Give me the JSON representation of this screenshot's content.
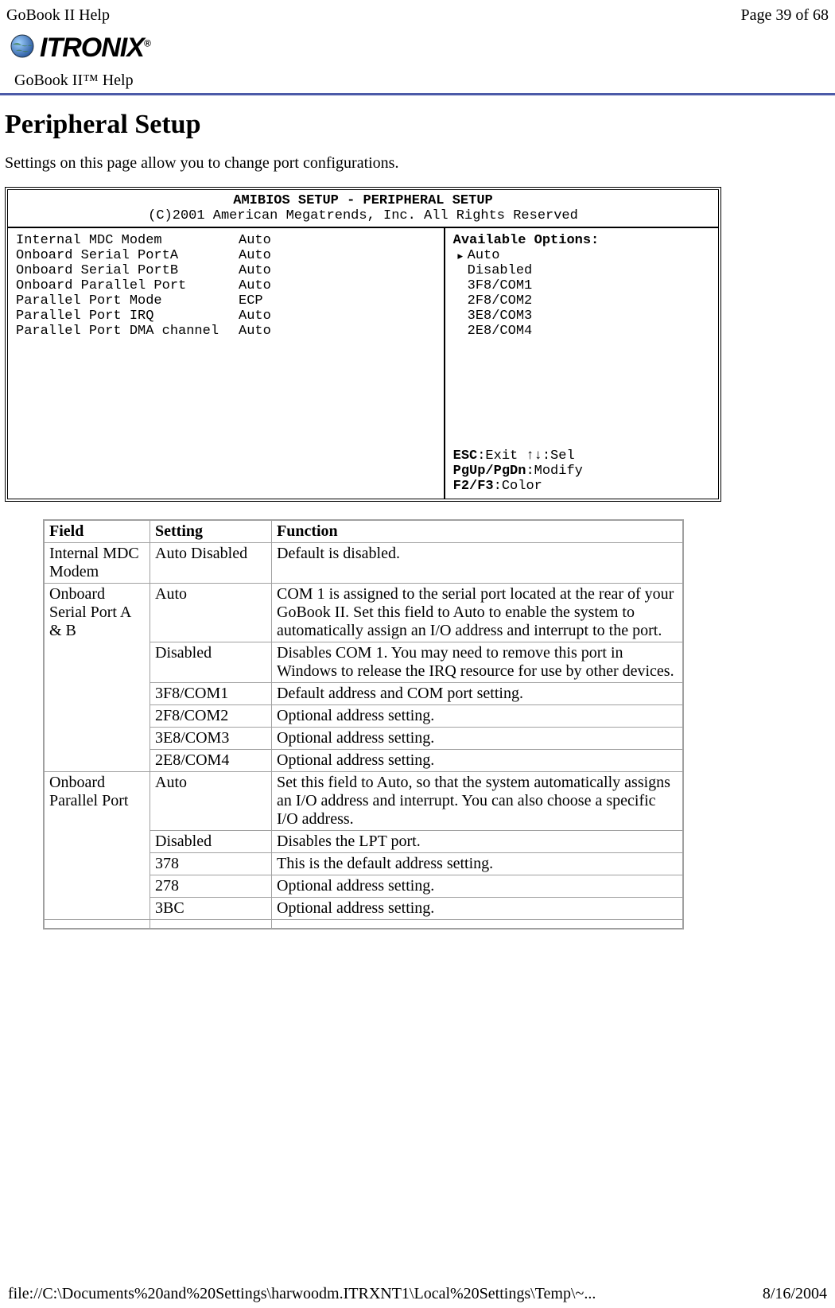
{
  "header": {
    "doc_title": "GoBook II Help",
    "page_indicator": "Page 39 of 68",
    "logo_text": "ITRONIX",
    "logo_r": "®",
    "help_label": "GoBook II™ Help"
  },
  "title": "Peripheral Setup",
  "intro": "Settings on this page allow you to change port configurations.",
  "bios": {
    "title": "AMIBIOS SETUP - PERIPHERAL SETUP",
    "copyright": "(C)2001 American Megatrends, Inc. All Rights Reserved",
    "rows": [
      {
        "label": "Internal MDC Modem",
        "value": "Auto"
      },
      {
        "label": "Onboard Serial PortA",
        "value": "Auto"
      },
      {
        "label": "Onboard Serial PortB",
        "value": "Auto"
      },
      {
        "label": "Onboard Parallel Port",
        "value": "Auto"
      },
      {
        "label": "Parallel Port Mode",
        "value": "ECP"
      },
      {
        "label": "Parallel Port IRQ",
        "value": "Auto"
      },
      {
        "label": "Parallel Port DMA channel",
        "value": "Auto"
      }
    ],
    "options_header": "Available Options:",
    "options": [
      "Auto",
      "Disabled",
      "3F8/COM1",
      "2F8/COM2",
      "3E8/COM3",
      "2E8/COM4"
    ],
    "footer": {
      "l1a": "ESC",
      "l1b": ":Exit  ↑↓:Sel",
      "l2a": "PgUp/PgDn",
      "l2b": ":Modify",
      "l3a": "F2/F3",
      "l3b": ":Color"
    }
  },
  "table": {
    "headers": {
      "field": "Field",
      "setting": "Setting",
      "function": "Function"
    },
    "r1": {
      "field": "Internal MDC Modem",
      "setting": "Auto Disabled",
      "function": "Default is disabled."
    },
    "r2_field": "Onboard Serial Port A & B",
    "r2": {
      "setting": "Auto",
      "function": "COM 1 is assigned to the serial port located at the rear of your GoBook II.  Set this field to Auto to enable the system to automatically assign an I/O address and interrupt to the port."
    },
    "r3": {
      "setting": "Disabled",
      "function": "Disables COM 1.  You may need to remove this port in Windows to release the IRQ resource for use by other devices."
    },
    "r4": {
      "setting": "3F8/COM1",
      "function": "Default address and COM port setting."
    },
    "r5": {
      "setting": "2F8/COM2",
      "function": "Optional address setting."
    },
    "r6": {
      "setting": "3E8/COM3",
      "function": "Optional address setting."
    },
    "r7": {
      "setting": "2E8/COM4",
      "function": "Optional address setting."
    },
    "r8_field": "Onboard Parallel Port",
    "r8": {
      "setting": "Auto",
      "function": "Set this field to Auto, so that the system automatically assigns an I/O address and interrupt.  You can also choose a specific I/O address."
    },
    "r9": {
      "setting": "Disabled",
      "function": "Disables the LPT port."
    },
    "r10": {
      "setting": "378",
      "function": "This is the default address setting."
    },
    "r11": {
      "setting": "278",
      "function": "Optional address setting."
    },
    "r12": {
      "setting": "3BC",
      "function": "Optional address setting."
    }
  },
  "footer": {
    "path": "file://C:\\Documents%20and%20Settings\\harwoodm.ITRXNT1\\Local%20Settings\\Temp\\~...",
    "date": "8/16/2004"
  }
}
